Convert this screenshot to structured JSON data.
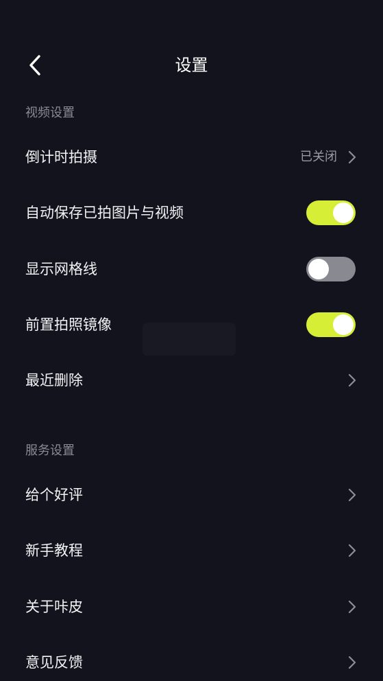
{
  "header": {
    "title": "设置"
  },
  "sections": {
    "video": {
      "title": "视频设置",
      "countdown": {
        "label": "倒计时拍摄",
        "value": "已关闭"
      },
      "autosave": {
        "label": "自动保存已拍图片与视频",
        "enabled": true
      },
      "grid": {
        "label": "显示网格线",
        "enabled": false
      },
      "mirror": {
        "label": "前置拍照镜像",
        "enabled": true
      },
      "recent_deleted": {
        "label": "最近删除"
      }
    },
    "service": {
      "title": "服务设置",
      "rate": {
        "label": "给个好评"
      },
      "tutorial": {
        "label": "新手教程"
      },
      "about": {
        "label": "关于咔皮"
      },
      "feedback": {
        "label": "意见反馈"
      }
    }
  },
  "colors": {
    "background": "#13131d",
    "toggle_on": "#d7ee37",
    "toggle_off": "#898991",
    "section_text": "#8a8a94"
  },
  "icons": {
    "back": "chevron-left-icon",
    "row_arrow": "chevron-right-icon"
  }
}
